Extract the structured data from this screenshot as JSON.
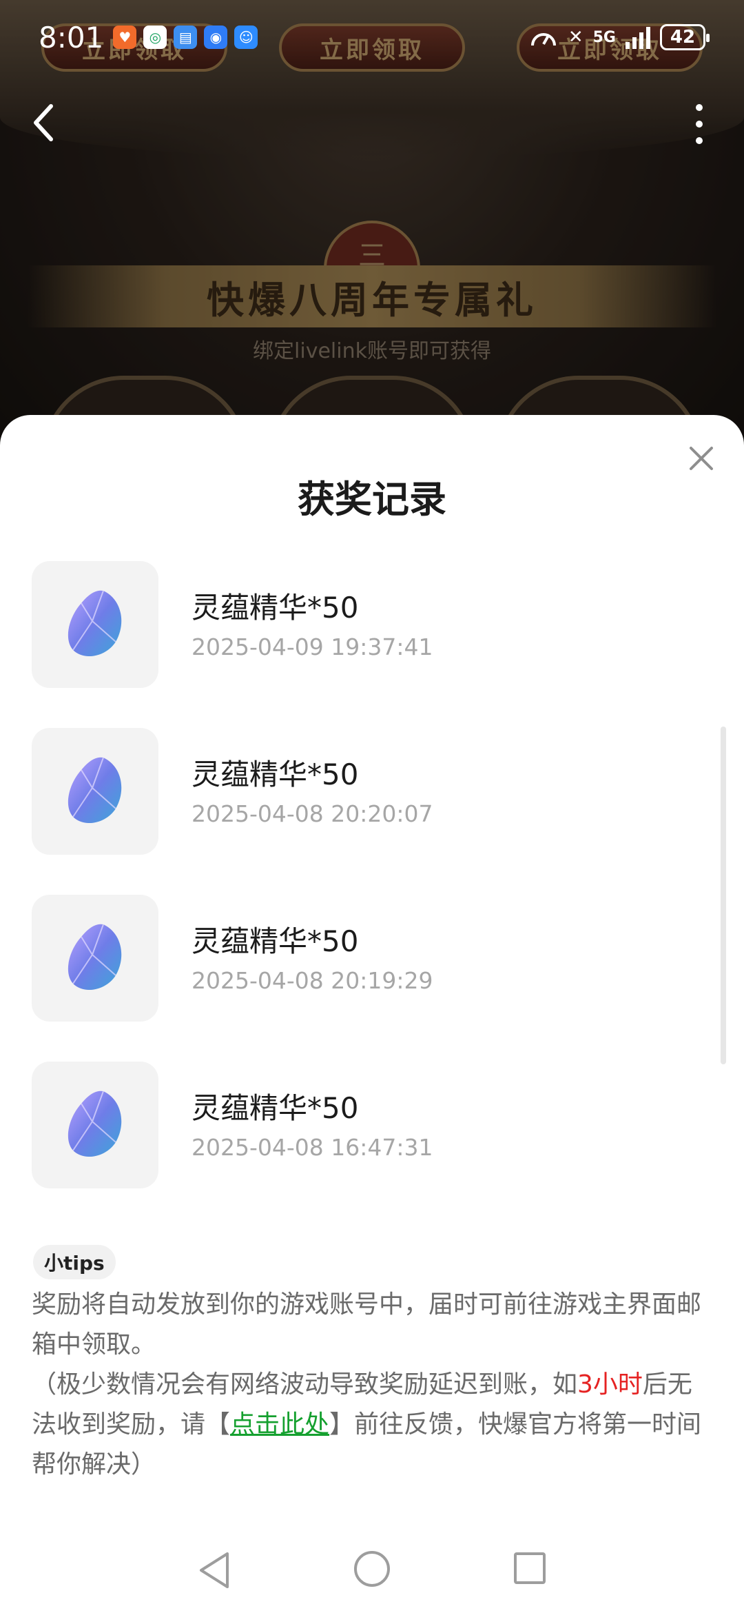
{
  "status_bar": {
    "time": "8:01",
    "network": "5G",
    "battery": "42",
    "app_icons": [
      "weibo-icon",
      "mobile-icon",
      "notes-icon",
      "browser-icon",
      "assistant-icon"
    ]
  },
  "background_page": {
    "claim_buttons": [
      "立即领取",
      "立即领取",
      "立即领取"
    ],
    "section_number": "三",
    "section_title": "快爆八周年专属礼",
    "section_subtitle": "绑定livelink账号即可获得"
  },
  "sheet": {
    "title": "获奖记录",
    "records": [
      {
        "name": "灵蕴精华*50",
        "time": "2025-04-09 19:37:41"
      },
      {
        "name": "灵蕴精华*50",
        "time": "2025-04-08 20:20:07"
      },
      {
        "name": "灵蕴精华*50",
        "time": "2025-04-08 20:19:29"
      },
      {
        "name": "灵蕴精华*50",
        "time": "2025-04-08 16:47:31"
      }
    ],
    "tips": {
      "badge": "小tips",
      "line1": "奖励将自动发放到你的游戏账号中，届时可前往游戏主界面邮箱中领取。",
      "line2_a": "（极少数情况会有网络波动导致奖励延迟到账，如",
      "line2_highlight": "3小时",
      "line2_b": "后无法收到奖励，请【",
      "link": "点击此处",
      "line2_c": "】前往反馈，快爆官方将第一时间帮你解决）"
    }
  },
  "colors": {
    "highlight": "#e52222",
    "link": "#15a02f",
    "secondary_text": "#a6a6a6"
  }
}
